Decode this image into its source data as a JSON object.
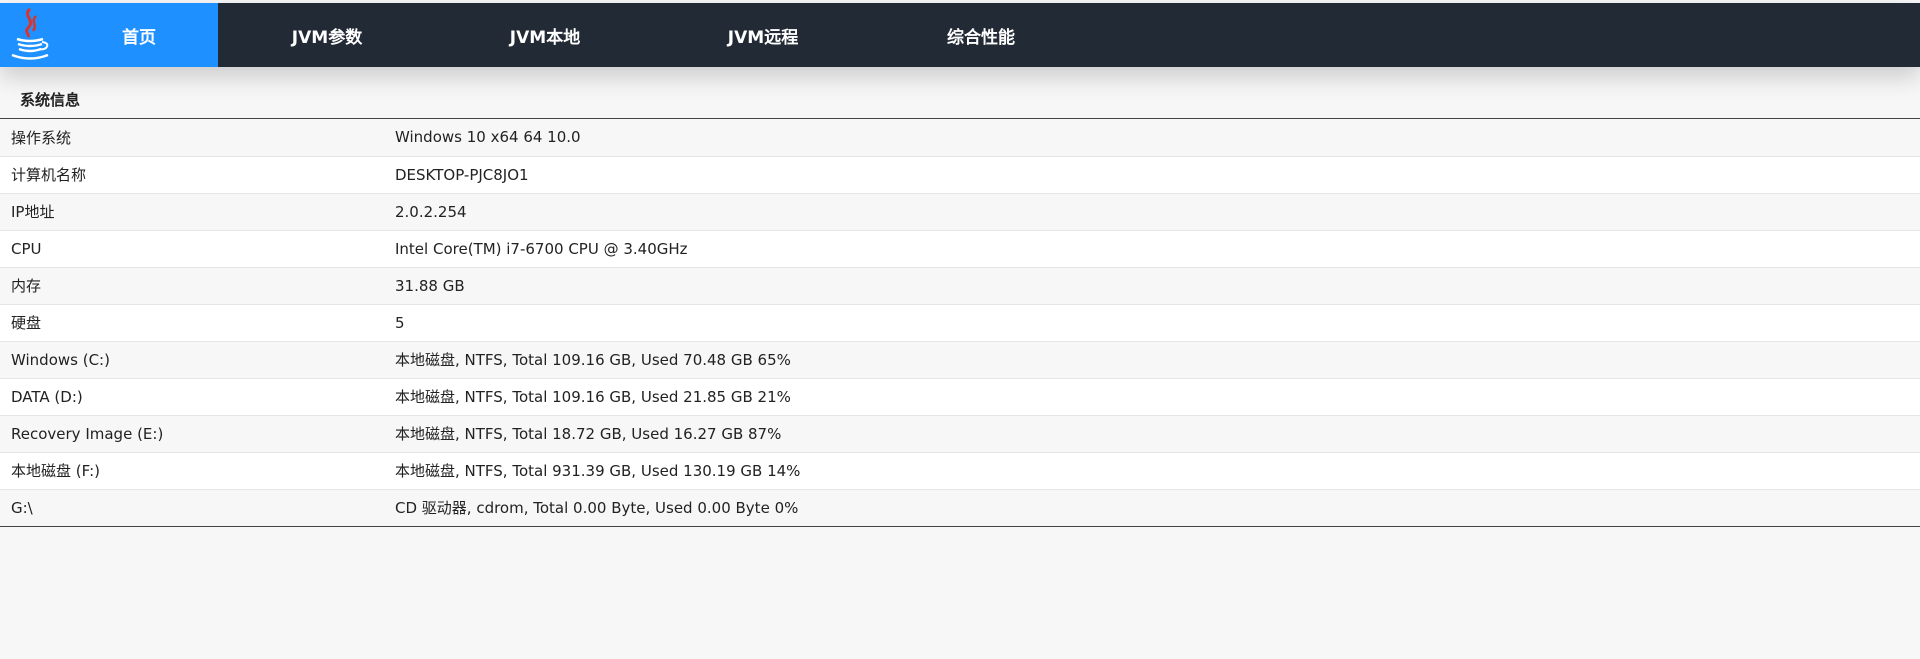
{
  "nav": {
    "logo_icon": "java-coffee-cup-icon",
    "items": [
      {
        "label": "首页",
        "active": true
      },
      {
        "label": "JVM参数",
        "active": false
      },
      {
        "label": "JVM本地",
        "active": false
      },
      {
        "label": "JVM远程",
        "active": false
      },
      {
        "label": "综合性能",
        "active": false
      }
    ],
    "colors": {
      "bar": "#222a35",
      "active": "#1f90ff"
    }
  },
  "system_info": {
    "title": "系统信息",
    "rows": [
      {
        "key": "操作系统",
        "value": "Windows 10 x64 64 10.0"
      },
      {
        "key": "计算机名称",
        "value": "DESKTOP-PJC8JO1"
      },
      {
        "key": "IP地址",
        "value": "2.0.2.254"
      },
      {
        "key": "CPU",
        "value": "Intel Core(TM) i7-6700 CPU @ 3.40GHz"
      },
      {
        "key": "内存",
        "value": "31.88 GB"
      },
      {
        "key": "硬盘",
        "value": "5"
      },
      {
        "key": "Windows (C:)",
        "value": "本地磁盘, NTFS, Total 109.16 GB, Used 70.48 GB 65%"
      },
      {
        "key": "DATA (D:)",
        "value": "本地磁盘, NTFS, Total 109.16 GB, Used 21.85 GB 21%"
      },
      {
        "key": "Recovery Image (E:)",
        "value": "本地磁盘, NTFS, Total 18.72 GB, Used 16.27 GB 87%"
      },
      {
        "key": "本地磁盘 (F:)",
        "value": "本地磁盘, NTFS, Total 931.39 GB, Used 130.19 GB 14%"
      },
      {
        "key": "G:\\",
        "value": "CD 驱动器, cdrom, Total 0.00 Byte, Used 0.00 Byte 0%"
      }
    ]
  }
}
